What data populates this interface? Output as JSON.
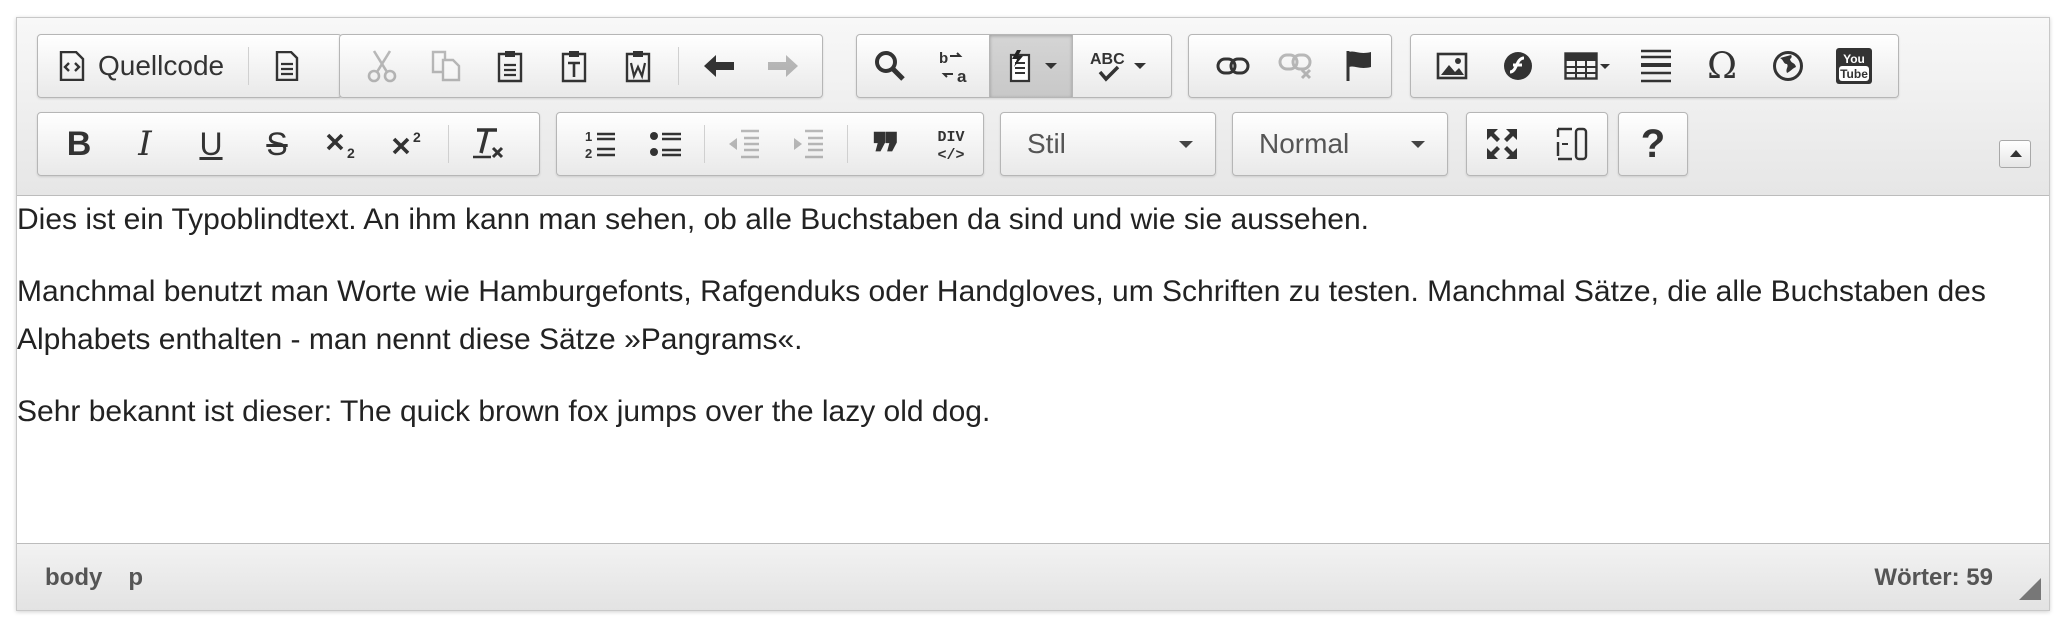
{
  "toolbar": {
    "source_label": "Quellcode",
    "style_combo": "Stil",
    "format_combo": "Normal",
    "help_label": "?",
    "icons": {
      "document": "document-icon",
      "cut": "cut-icon",
      "copy": "copy-icon",
      "paste": "paste-icon",
      "paste_text": "paste-text-icon",
      "paste_word": "paste-word-icon",
      "undo": "undo-icon",
      "redo": "redo-icon",
      "find": "search-icon",
      "replace": "replace-icon",
      "template": "template-icon",
      "spellcheck": "spellcheck-icon",
      "link": "link-icon",
      "unlink": "unlink-icon",
      "anchor": "flag-icon",
      "image": "image-icon",
      "flash": "flash-icon",
      "table": "table-icon",
      "hr": "horizontal-rule-icon",
      "special_char": "omega-icon",
      "iframe": "globe-icon",
      "youtube": "youtube-icon",
      "bold": "bold-icon",
      "italic": "italic-icon",
      "underline": "underline-icon",
      "strike": "strikethrough-icon",
      "subscript": "subscript-icon",
      "superscript": "superscript-icon",
      "remove_format": "remove-format-icon",
      "numbered_list": "numbered-list-icon",
      "bulleted_list": "bulleted-list-icon",
      "outdent": "outdent-icon",
      "indent": "indent-icon",
      "blockquote": "blockquote-icon",
      "div": "div-icon",
      "maximize": "maximize-icon",
      "show_blocks": "show-blocks-icon",
      "help": "help-icon"
    },
    "texts": {
      "bold": "B",
      "italic": "I",
      "underline": "U",
      "strike": "S",
      "omega": "Ω",
      "quote": "❞",
      "abc": "ABC",
      "div_top": "DIV",
      "div_bottom": "</>",
      "youtube_top": "You",
      "youtube_bottom": "Tube"
    }
  },
  "content": {
    "paragraphs": [
      "Dies ist ein Typoblindtext. An ihm kann man sehen, ob alle Buchstaben da sind und wie sie aussehen.",
      "Manchmal benutzt man Worte wie Hamburgefonts, Rafgenduks oder Handgloves, um Schriften zu testen. Manchmal Sätze, die alle Buchstaben des Alphabets enthalten - man nennt diese Sätze »Pangrams«.",
      "Sehr bekannt ist dieser: The quick brown fox jumps over the lazy old dog."
    ]
  },
  "statusbar": {
    "path": [
      "body",
      "p"
    ],
    "word_count": "Wörter: 59"
  }
}
